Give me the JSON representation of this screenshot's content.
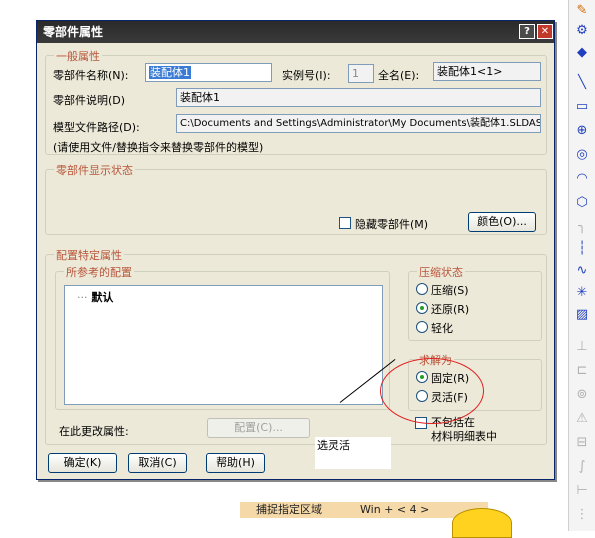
{
  "dialog": {
    "title": "零部件属性",
    "help_btn": "?",
    "close_btn": "✕"
  },
  "general": {
    "legend": "一般属性",
    "name_label": "零部件名称(N):",
    "name_value": "装配体1",
    "instance_label": "实例号(I):",
    "instance_value": "1",
    "fullname_label": "全名(E):",
    "fullname_value": "装配体1<1>",
    "desc_label": "零部件说明(D)",
    "desc_value": "装配体1",
    "path_label": "模型文件路径(D):",
    "path_value": "C:\\Documents and Settings\\Administrator\\My Documents\\装配体1.SLDASM",
    "hint": "(请使用文件/替换指令来替换零部件的模型)"
  },
  "display": {
    "legend": "零部件显示状态",
    "hide_label": "隐藏零部件(M)",
    "color_btn": "颜色(O)..."
  },
  "config": {
    "legend": "配置特定属性",
    "ref_legend": "所参考的配置",
    "items": [
      "默认"
    ],
    "suppress_legend": "压缩状态",
    "suppress_options": [
      "压缩(S)",
      "还原(R)",
      "轻化"
    ],
    "suppress_selected": 1,
    "solve_legend": "求解为",
    "solve_options": [
      "固定(R)",
      "灵活(F)"
    ],
    "solve_selected": 0,
    "change_label": "在此更改属性:",
    "config_btn": "配置(C)...",
    "exclude_line1": "不包括在",
    "exclude_line2": "材料明细表中"
  },
  "buttons": {
    "ok": "确定(K)",
    "cancel": "取消(C)",
    "help": "帮助(H)"
  },
  "annotation": {
    "note": "选灵活"
  },
  "statusbar": {
    "text": "捕捉指定区域",
    "shortcut": "Win + < 4 >"
  },
  "toolbar_icons": [
    "pencil-icon",
    "settings-icon",
    "line-icon",
    "rectangle-icon",
    "circle-icon",
    "arc-icon",
    "polygon-icon",
    "dashed-line-icon",
    "spline-icon",
    "point-icon",
    "hatch-icon",
    "dimension-icon",
    "constraint-icon",
    "mirror-icon"
  ]
}
